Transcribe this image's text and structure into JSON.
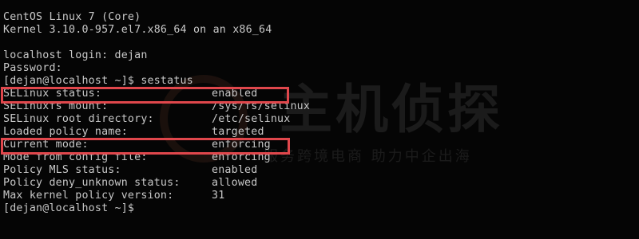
{
  "colors": {
    "background": "#050505",
    "text": "#c8c8c8",
    "highlight": "#e0474c"
  },
  "watermark": {
    "title": "主机侦探",
    "subtitle": "服务跨境电商 助力中企出海"
  },
  "terminal": {
    "lines": [
      {
        "text": "CentOS Linux 7 (Core)"
      },
      {
        "text": "Kernel 3.10.0-957.el7.x86_64 on an x86_64"
      },
      {
        "text": ""
      },
      {
        "text": "localhost login: dejan"
      },
      {
        "text": "Password:"
      },
      {
        "text": "[dejan@localhost ~]$ sestatus"
      },
      {
        "text": "SELinux status:",
        "value": "enabled",
        "highlighted": true
      },
      {
        "text": "SELinuxfs mount:",
        "value": "/sys/fs/selinux"
      },
      {
        "text": "SELinux root directory:",
        "value": "/etc/selinux"
      },
      {
        "text": "Loaded policy name:",
        "value": "targeted"
      },
      {
        "text": "Current mode:",
        "value": "enforcing",
        "highlighted": true
      },
      {
        "text": "Mode from config file:",
        "value": "enforcing"
      },
      {
        "text": "Policy MLS status:",
        "value": "enabled"
      },
      {
        "text": "Policy deny_unknown status:",
        "value": "allowed"
      },
      {
        "text": "Max kernel policy version:",
        "value": "31"
      },
      {
        "text": "[dejan@localhost ~]$"
      }
    ]
  }
}
